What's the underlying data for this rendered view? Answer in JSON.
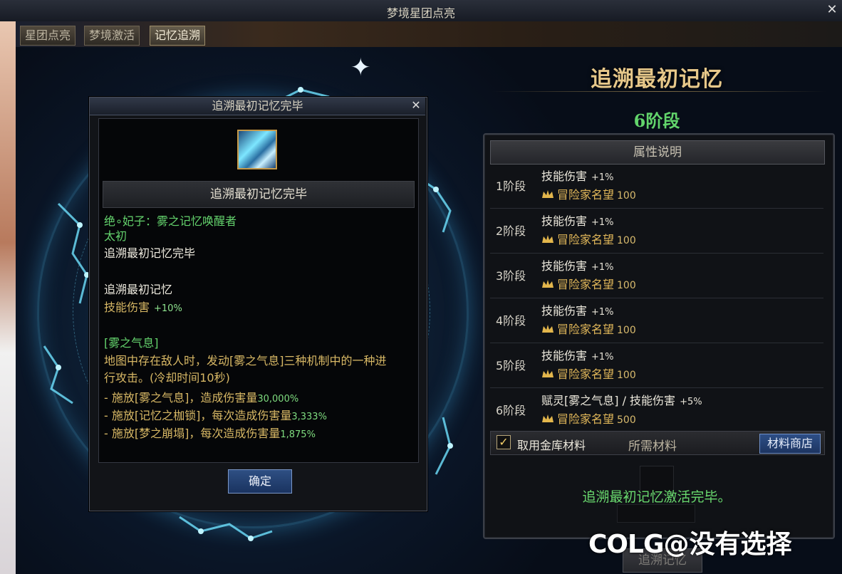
{
  "window": {
    "title": "梦境星团点亮",
    "close": "✕"
  },
  "tabs": [
    {
      "label": "星团点亮",
      "active": false
    },
    {
      "label": "梦境激活",
      "active": false
    },
    {
      "label": "记忆追溯",
      "active": true
    }
  ],
  "right": {
    "title": "追溯最初记忆",
    "stage": "6阶段",
    "attr_header": "属性说明",
    "stages": [
      {
        "label": "1阶段",
        "attr": "技能伤害",
        "attr_value": "+1%",
        "rep_label": "冒险家名望",
        "rep_value": "100"
      },
      {
        "label": "2阶段",
        "attr": "技能伤害",
        "attr_value": "+1%",
        "rep_label": "冒险家名望",
        "rep_value": "100"
      },
      {
        "label": "3阶段",
        "attr": "技能伤害",
        "attr_value": "+1%",
        "rep_label": "冒险家名望",
        "rep_value": "100"
      },
      {
        "label": "4阶段",
        "attr": "技能伤害",
        "attr_value": "+1%",
        "rep_label": "冒险家名望",
        "rep_value": "100"
      },
      {
        "label": "5阶段",
        "attr": "技能伤害",
        "attr_value": "+1%",
        "rep_label": "冒险家名望",
        "rep_value": "100"
      },
      {
        "label": "6阶段",
        "attr": "赋灵[雾之气息] / 技能伤害",
        "attr_value": "+5%",
        "rep_label": "冒险家名望",
        "rep_value": "500"
      }
    ],
    "use_vault_checked": true,
    "use_vault_label": "取用金库材料",
    "required_materials": "所需材料",
    "shop_button": "材料商店",
    "done_text": "追溯最初记忆激活完毕。",
    "trace_button": "追溯记忆"
  },
  "dialog": {
    "title": "追溯最初记忆完毕",
    "close": "✕",
    "item_name": "追溯最初记忆完毕",
    "lines": {
      "l1": "绝∘妃子：雾之记忆唤醒者",
      "l2": "太初",
      "l3": "追溯最初记忆完毕",
      "l4": "追溯最初记忆",
      "l5_label": "技能伤害",
      "l5_value": "+10%",
      "l6": "[雾之气息]",
      "l7": "地图中存在敌人时，发动[雾之气息]三种机制中的一种进",
      "l8": "行攻击。(冷却时间10秒)",
      "l9_text": "- 施放[雾之气息]，造成伤害量",
      "l9_value": "30,000%",
      "l10_text": "- 施放[记忆之枷锁]，每次造成伤害量",
      "l10_value": "3,333%",
      "l11_text": "- 施放[梦之崩塌]，每次造成伤害量",
      "l11_value": "1,875%"
    },
    "ok_button": "确定"
  },
  "watermark": {
    "logo": "COLG",
    "text": "@没有选择"
  },
  "colors": {
    "accent_green": "#64d36d",
    "gold": "#e7c88a",
    "button_blue": "#1d3561"
  }
}
